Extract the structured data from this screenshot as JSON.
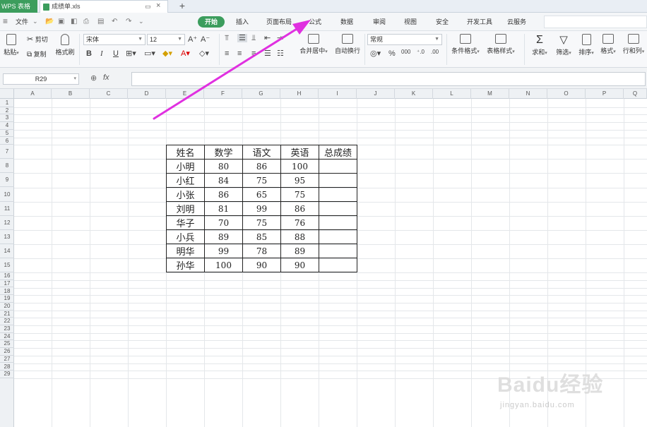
{
  "titlebar": {
    "app_label": "WPS 表格",
    "file_name": "成绩单.xls",
    "new_tab": "+"
  },
  "menubar": {
    "file_label": "文件",
    "tabs": [
      "开始",
      "插入",
      "页面布局",
      "公式",
      "数据",
      "审阅",
      "视图",
      "安全",
      "开发工具",
      "云服务"
    ],
    "active_tab": "开始"
  },
  "ribbon": {
    "paste": "粘贴",
    "cut": "剪切",
    "copy": "复制",
    "format_painter": "格式刷",
    "font_name": "宋体",
    "font_size": "12",
    "bold": "B",
    "italic": "I",
    "underline": "U",
    "merge_center": "合并居中",
    "wrap_text": "自动换行",
    "number_format": "常规",
    "percent": "%",
    "conditional_format": "条件格式",
    "table_style": "表格样式",
    "sum": "求和",
    "filter": "筛选",
    "sort": "排序",
    "format": "格式",
    "row_col": "行和列"
  },
  "formula_bar": {
    "name_box": "R29",
    "fx": "fx",
    "value": ""
  },
  "columns": [
    "A",
    "B",
    "C",
    "D",
    "E",
    "F",
    "G",
    "H",
    "I",
    "J",
    "K",
    "L",
    "M",
    "N",
    "O",
    "P",
    "Q"
  ],
  "rows": [
    "1",
    "2",
    "3",
    "4",
    "5",
    "6",
    "7",
    "8",
    "9",
    "10",
    "11",
    "12",
    "13",
    "14",
    "15",
    "16",
    "17",
    "18",
    "19",
    "20",
    "21",
    "22",
    "23",
    "24",
    "25",
    "26",
    "27",
    "28",
    "29"
  ],
  "table": {
    "headers": [
      "姓名",
      "数学",
      "语文",
      "英语",
      "总成绩"
    ],
    "rows": [
      {
        "name": "小明",
        "math": "80",
        "chinese": "86",
        "english": "100",
        "total": ""
      },
      {
        "name": "小红",
        "math": "84",
        "chinese": "75",
        "english": "95",
        "total": ""
      },
      {
        "name": "小张",
        "math": "86",
        "chinese": "65",
        "english": "75",
        "total": ""
      },
      {
        "name": "刘明",
        "math": "81",
        "chinese": "99",
        "english": "86",
        "total": ""
      },
      {
        "name": "华子",
        "math": "70",
        "chinese": "75",
        "english": "76",
        "total": ""
      },
      {
        "name": "小兵",
        "math": "89",
        "chinese": "85",
        "english": "88",
        "total": ""
      },
      {
        "name": "明华",
        "math": "99",
        "chinese": "78",
        "english": "89",
        "total": ""
      },
      {
        "name": "孙华",
        "math": "100",
        "chinese": "90",
        "english": "90",
        "total": ""
      }
    ]
  },
  "annotation": {
    "arrow_color": "#e030e0"
  },
  "watermark": {
    "brand": "Baidu经验",
    "url": "jingyan.baidu.com"
  }
}
